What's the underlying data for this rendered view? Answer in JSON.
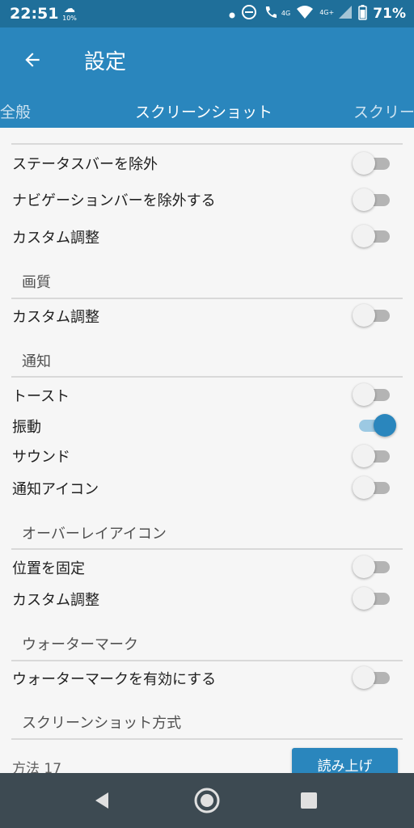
{
  "status_bar": {
    "time": "22:51",
    "data_indicator": "10%",
    "network_4g": "4G",
    "network_4g_plus": "4G+",
    "battery_percent": "71%"
  },
  "app_bar": {
    "title": "設定"
  },
  "tabs": {
    "left": "全般",
    "center": "スクリーンショット",
    "right": "スクリー"
  },
  "rows": {
    "exclude_status_bar": "ステータスバーを除外",
    "exclude_nav_bar": "ナビゲーションバーを除外する",
    "custom_adjust_1": "カスタム調整",
    "custom_adjust_2": "カスタム調整",
    "toast": "トースト",
    "vibration": "振動",
    "sound": "サウンド",
    "notification_icon": "通知アイコン",
    "fix_position": "位置を固定",
    "custom_adjust_3": "カスタム調整",
    "enable_watermark": "ウォーターマークを有効にする",
    "method_label": "方法 17"
  },
  "sections": {
    "image_quality": "画質",
    "notification": "通知",
    "overlay_icon": "オーバーレイアイコン",
    "watermark": "ウォーターマーク",
    "screenshot_method": "スクリーンショット方式"
  },
  "toggles": {
    "exclude_status_bar": false,
    "exclude_nav_bar": false,
    "custom_adjust_1": false,
    "custom_adjust_2": false,
    "toast": false,
    "vibration": true,
    "sound": false,
    "notification_icon": false,
    "fix_position": false,
    "custom_adjust_3": false,
    "enable_watermark": false
  },
  "buttons": {
    "read_button": "読み上げ"
  },
  "colors": {
    "primary": "#2a86bd",
    "status_bar": "#1f6f9a",
    "nav_bar": "#3d4a52"
  }
}
